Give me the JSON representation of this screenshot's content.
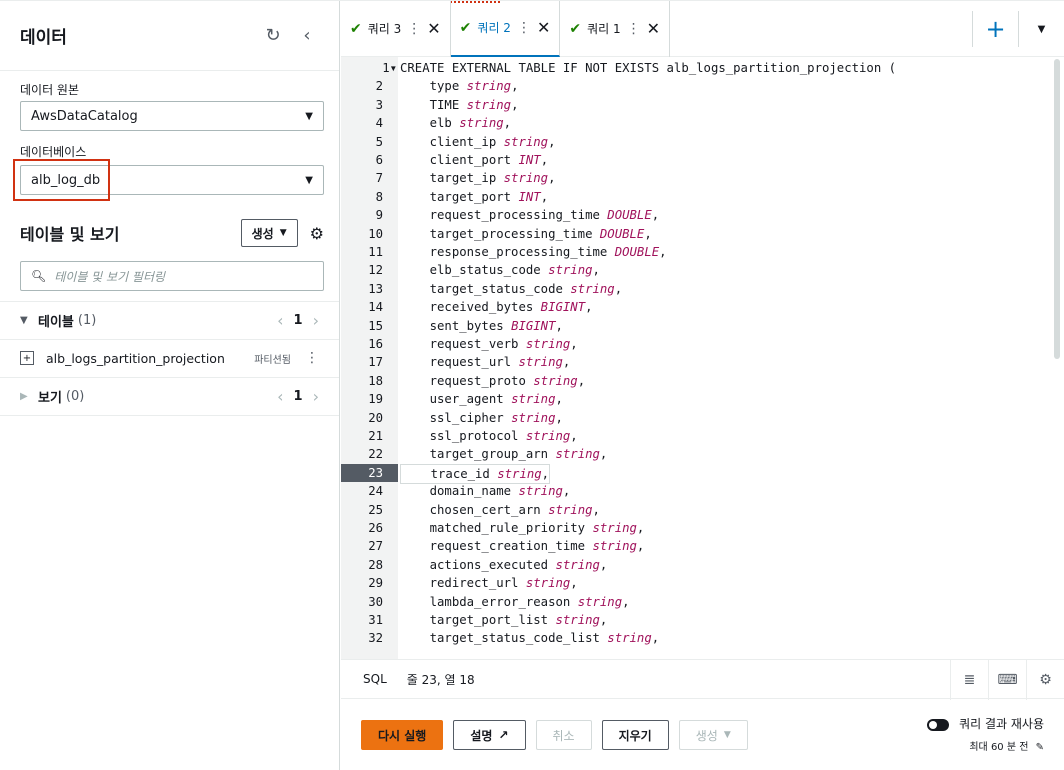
{
  "left": {
    "title": "데이터",
    "refresh_icon": "refresh-icon",
    "collapse_icon": "chevron-left-icon",
    "source_label": "데이터 원본",
    "source_value": "AwsDataCatalog",
    "db_label": "데이터베이스",
    "db_value": "alb_log_db",
    "tables_views_title": "테이블 및 보기",
    "create_label": "생성",
    "filter_placeholder": "테이블 및 보기 필터링",
    "tables_heading": "테이블",
    "tables_count": "(1)",
    "tables_page": "1",
    "table_item": "alb_logs_partition_projection",
    "table_badge": "파티션됨",
    "views_heading": "보기",
    "views_count": "(0)",
    "views_page": "1"
  },
  "tabs": [
    {
      "label": "쿼리 3",
      "active": false
    },
    {
      "label": "쿼리 2",
      "active": true
    },
    {
      "label": "쿼리 1",
      "active": false
    }
  ],
  "editor": {
    "lines": [
      [
        "1",
        "CREATE EXTERNAL TABLE IF NOT EXISTS alb_logs_partition_projection (",
        ""
      ],
      [
        "2",
        "    type ",
        "string"
      ],
      [
        "3",
        "    TIME ",
        "string"
      ],
      [
        "4",
        "    elb ",
        "string"
      ],
      [
        "5",
        "    client_ip ",
        "string"
      ],
      [
        "6",
        "    client_port ",
        "INT"
      ],
      [
        "7",
        "    target_ip ",
        "string"
      ],
      [
        "8",
        "    target_port ",
        "INT"
      ],
      [
        "9",
        "    request_processing_time ",
        "DOUBLE"
      ],
      [
        "10",
        "    target_processing_time ",
        "DOUBLE"
      ],
      [
        "11",
        "    response_processing_time ",
        "DOUBLE"
      ],
      [
        "12",
        "    elb_status_code ",
        "string"
      ],
      [
        "13",
        "    target_status_code ",
        "string"
      ],
      [
        "14",
        "    received_bytes ",
        "BIGINT"
      ],
      [
        "15",
        "    sent_bytes ",
        "BIGINT"
      ],
      [
        "16",
        "    request_verb ",
        "string"
      ],
      [
        "17",
        "    request_url ",
        "string"
      ],
      [
        "18",
        "    request_proto ",
        "string"
      ],
      [
        "19",
        "    user_agent ",
        "string"
      ],
      [
        "20",
        "    ssl_cipher ",
        "string"
      ],
      [
        "21",
        "    ssl_protocol ",
        "string"
      ],
      [
        "22",
        "    target_group_arn ",
        "string"
      ],
      [
        "23",
        "    trace_id ",
        "string"
      ],
      [
        "24",
        "    domain_name ",
        "string"
      ],
      [
        "25",
        "    chosen_cert_arn ",
        "string"
      ],
      [
        "26",
        "    matched_rule_priority ",
        "string"
      ],
      [
        "27",
        "    request_creation_time ",
        "string"
      ],
      [
        "28",
        "    actions_executed ",
        "string"
      ],
      [
        "29",
        "    redirect_url ",
        "string"
      ],
      [
        "30",
        "    lambda_error_reason ",
        "string"
      ],
      [
        "31",
        "    target_port_list ",
        "string"
      ],
      [
        "32",
        "    target_status_code_list ",
        "string"
      ]
    ],
    "current_line": 23
  },
  "status": {
    "language": "SQL",
    "position": "줄 23, 열 18"
  },
  "actions": {
    "run_again": "다시 실행",
    "explain": "설명",
    "cancel": "취소",
    "clear": "지우기",
    "create": "생성",
    "reuse_label": "쿼리 결과 재사용",
    "reuse_sub": "최대 60 분 전"
  },
  "colors": {
    "accent": "#0073bb",
    "primary_button": "#ec7211",
    "type_color": "#a0125b",
    "highlight": "#d13212"
  }
}
